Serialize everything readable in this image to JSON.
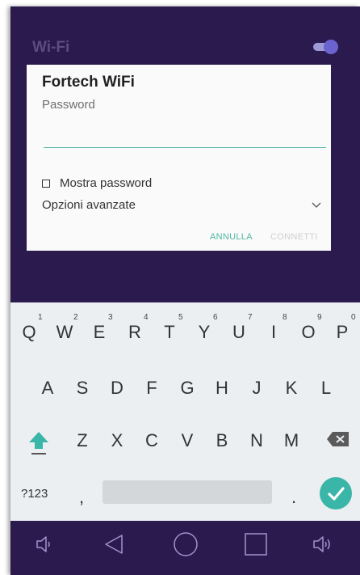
{
  "header": {
    "title": "Wi-Fi",
    "toggle_on": true
  },
  "dialog": {
    "network_name": "Fortech WiFi",
    "password_label": "Password",
    "password_value": "",
    "show_password_label": "Mostra password",
    "show_password_checked": false,
    "advanced_options_label": "Opzioni avanzate",
    "cancel_label": "ANNULLA",
    "connect_label": "CONNETTI",
    "accent_color": "#4fb5a3"
  },
  "keyboard": {
    "row1": [
      {
        "key": "Q",
        "hint": "1"
      },
      {
        "key": "W",
        "hint": "2"
      },
      {
        "key": "E",
        "hint": "3"
      },
      {
        "key": "R",
        "hint": "4"
      },
      {
        "key": "T",
        "hint": "5"
      },
      {
        "key": "Y",
        "hint": "6"
      },
      {
        "key": "U",
        "hint": "7"
      },
      {
        "key": "I",
        "hint": "8"
      },
      {
        "key": "O",
        "hint": "9"
      },
      {
        "key": "P",
        "hint": "0"
      }
    ],
    "row2": [
      "A",
      "S",
      "D",
      "F",
      "G",
      "H",
      "J",
      "K",
      "L"
    ],
    "row3": [
      "Z",
      "X",
      "C",
      "V",
      "B",
      "N",
      "M"
    ],
    "symbols_label": "?123",
    "comma": ",",
    "period": ".",
    "icons": {
      "shift": "shift-icon",
      "backspace": "backspace-icon",
      "enter": "checkmark-icon"
    },
    "enter_color": "#3ab6a8"
  },
  "navbar": {
    "icons": [
      "volume-down-icon",
      "back-icon",
      "home-icon",
      "recents-icon",
      "volume-up-icon"
    ],
    "color": "#2a1a4e"
  }
}
